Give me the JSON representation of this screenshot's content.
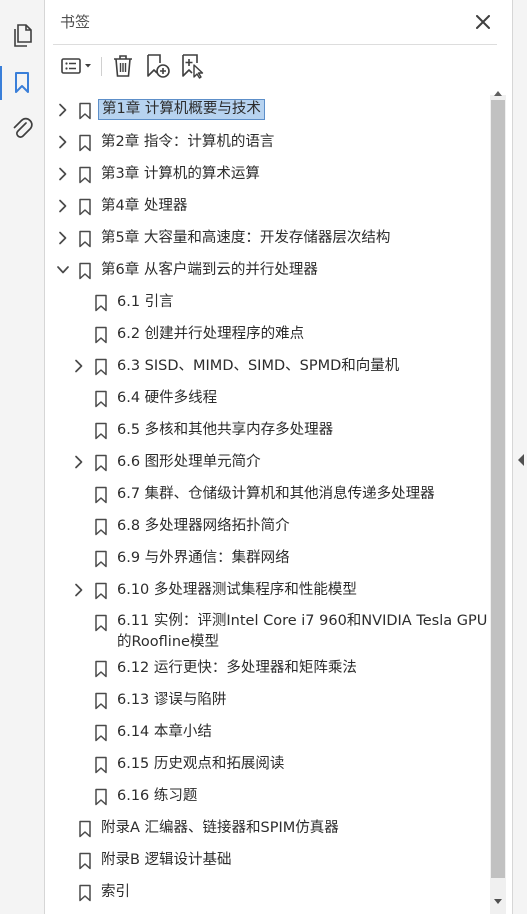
{
  "panel": {
    "title": "书签"
  },
  "bookmarks": [
    {
      "label": "第1章 计算机概要与技术",
      "expandable": true,
      "expanded": false,
      "level": 0,
      "selected": true
    },
    {
      "label": "第2章 指令：计算机的语言",
      "expandable": true,
      "expanded": false,
      "level": 0
    },
    {
      "label": "第3章 计算机的算术运算",
      "expandable": true,
      "expanded": false,
      "level": 0
    },
    {
      "label": "第4章 处理器",
      "expandable": true,
      "expanded": false,
      "level": 0
    },
    {
      "label": "第5章 大容量和高速度：开发存储器层次结构",
      "expandable": true,
      "expanded": false,
      "level": 0
    },
    {
      "label": "第6章 从客户端到云的并行处理器",
      "expandable": true,
      "expanded": true,
      "level": 0
    },
    {
      "label": "6.1 引言",
      "expandable": false,
      "level": 1
    },
    {
      "label": "6.2 创建并行处理程序的难点",
      "expandable": false,
      "level": 1
    },
    {
      "label": "6.3 SISD、MIMD、SIMD、SPMD和向量机",
      "expandable": true,
      "expanded": false,
      "level": 1
    },
    {
      "label": "6.4 硬件多线程",
      "expandable": false,
      "level": 1
    },
    {
      "label": "6.5 多核和其他共享内存多处理器",
      "expandable": false,
      "level": 1
    },
    {
      "label": "6.6 图形处理单元简介",
      "expandable": true,
      "expanded": false,
      "level": 1
    },
    {
      "label": "6.7 集群、仓储级计算机和其他消息传递多处理器",
      "expandable": false,
      "level": 1
    },
    {
      "label": "6.8 多处理器网络拓扑简介",
      "expandable": false,
      "level": 1
    },
    {
      "label": "6.9 与外界通信：集群网络",
      "expandable": false,
      "level": 1
    },
    {
      "label": "6.10 多处理器测试集程序和性能模型",
      "expandable": true,
      "expanded": false,
      "level": 1
    },
    {
      "label": "6.11 实例：评测Intel Core i7 960和NVIDIA Tesla GPU的Roofline模型",
      "expandable": false,
      "level": 1
    },
    {
      "label": "6.12 运行更快：多处理器和矩阵乘法",
      "expandable": false,
      "level": 1
    },
    {
      "label": "6.13 谬误与陷阱",
      "expandable": false,
      "level": 1
    },
    {
      "label": "6.14 本章小结",
      "expandable": false,
      "level": 1
    },
    {
      "label": "6.15 历史观点和拓展阅读",
      "expandable": false,
      "level": 1
    },
    {
      "label": "6.16 练习题",
      "expandable": false,
      "level": 1
    },
    {
      "label": "附录A 汇编器、链接器和SPIM仿真器",
      "expandable": false,
      "level": 0
    },
    {
      "label": "附录B 逻辑设计基础",
      "expandable": false,
      "level": 0
    },
    {
      "label": "索引",
      "expandable": false,
      "level": 0
    }
  ],
  "rail": {
    "icons": [
      "page-thumbnails-icon",
      "bookmarks-icon",
      "attachments-icon"
    ],
    "active": "bookmarks-icon"
  },
  "toolbar": {
    "icons": [
      "options-menu-icon",
      "delete-bookmark-icon",
      "new-bookmark-icon",
      "new-bookmark-from-structure-icon"
    ]
  },
  "colors": {
    "accent": "#3a7fd9",
    "selection_bg": "#b7d3f0",
    "selection_border": "#5d8fc9",
    "icon": "#4a4a4a"
  }
}
